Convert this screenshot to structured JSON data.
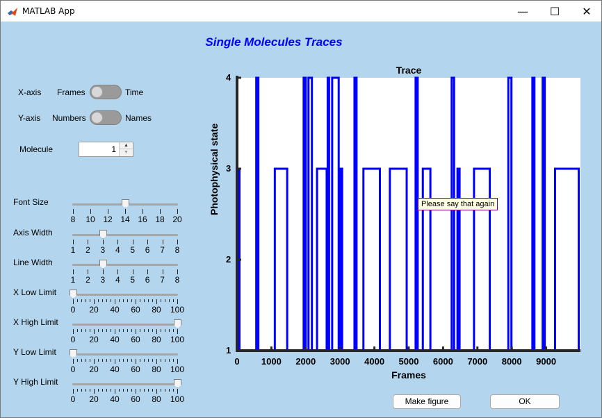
{
  "window": {
    "title": "MATLAB App",
    "minimize_glyph": "—",
    "maximize_glyph": "☐",
    "close_glyph": "✕",
    "app_icon": "matlab-logo-icon"
  },
  "header": {
    "title": "Single Molecules Traces"
  },
  "controls": {
    "xaxis": {
      "label": "X-axis",
      "left": "Frames",
      "right": "Time",
      "state": "Frames"
    },
    "yaxis": {
      "label": "Y-axis",
      "left": "Numbers",
      "right": "Names",
      "state": "Numbers"
    },
    "molecule": {
      "label": "Molecule",
      "value": "1"
    }
  },
  "sliders": [
    {
      "label": "Font Size",
      "min": 8,
      "max": 20,
      "value": 14,
      "major": [
        8,
        10,
        12,
        14,
        16,
        18,
        20
      ],
      "minor": []
    },
    {
      "label": "Axis Width",
      "min": 1,
      "max": 8,
      "value": 3,
      "major": [
        1,
        2,
        3,
        4,
        5,
        6,
        7,
        8
      ],
      "minor": []
    },
    {
      "label": "Line Width",
      "min": 1,
      "max": 8,
      "value": 3,
      "major": [
        1,
        2,
        3,
        4,
        5,
        6,
        7,
        8
      ],
      "minor": []
    },
    {
      "label": "X Low Limit",
      "min": 0,
      "max": 100,
      "value": 0,
      "major": [
        0,
        20,
        40,
        60,
        80,
        100
      ],
      "minor_step": 4
    },
    {
      "label": "X High Limit",
      "min": 0,
      "max": 100,
      "value": 100,
      "major": [
        0,
        20,
        40,
        60,
        80,
        100
      ],
      "minor_step": 4
    },
    {
      "label": "Y Low Limit",
      "min": 0,
      "max": 100,
      "value": 0,
      "major": [
        0,
        20,
        40,
        60,
        80,
        100
      ],
      "minor_step": 4
    },
    {
      "label": "Y High Limit",
      "min": 0,
      "max": 100,
      "value": 100,
      "major": [
        0,
        20,
        40,
        60,
        80,
        100
      ],
      "minor_step": 4
    }
  ],
  "tooltip": {
    "text": "Please say that again"
  },
  "buttons": {
    "make_figure": "Make figure",
    "ok": "OK"
  },
  "colors": {
    "background": "#b3d6ee",
    "trace": "#0000ff",
    "title": "#0000ff"
  },
  "chart_data": {
    "type": "line",
    "title": "Trace",
    "xlabel": "Frames",
    "ylabel": "Photophysical state",
    "xlim": [
      0,
      10000
    ],
    "ylim": [
      1,
      4
    ],
    "xticks": [
      0,
      1000,
      2000,
      3000,
      4000,
      5000,
      6000,
      7000,
      8000,
      9000
    ],
    "yticks": [
      1,
      2,
      3,
      4
    ],
    "grid": false,
    "series": [
      {
        "color": "#0000ff",
        "steps": [
          [
            0,
            3
          ],
          [
            70,
            1
          ],
          [
            560,
            4
          ],
          [
            620,
            1
          ],
          [
            1100,
            3
          ],
          [
            1460,
            1
          ],
          [
            1940,
            4
          ],
          [
            2000,
            1
          ],
          [
            2080,
            4
          ],
          [
            2180,
            1
          ],
          [
            2330,
            3
          ],
          [
            2610,
            1
          ],
          [
            2640,
            4
          ],
          [
            2680,
            1
          ],
          [
            2770,
            4
          ],
          [
            2960,
            1
          ],
          [
            3000,
            3
          ],
          [
            3060,
            1
          ],
          [
            3420,
            4
          ],
          [
            3480,
            1
          ],
          [
            3680,
            3
          ],
          [
            4160,
            1
          ],
          [
            4450,
            3
          ],
          [
            4940,
            1
          ],
          [
            5200,
            4
          ],
          [
            5260,
            1
          ],
          [
            5410,
            3
          ],
          [
            5630,
            1
          ],
          [
            6250,
            4
          ],
          [
            6320,
            1
          ],
          [
            6420,
            3
          ],
          [
            6480,
            1
          ],
          [
            6900,
            3
          ],
          [
            7360,
            1
          ],
          [
            7900,
            4
          ],
          [
            7990,
            1
          ],
          [
            8600,
            4
          ],
          [
            8660,
            1
          ],
          [
            8900,
            4
          ],
          [
            8960,
            1
          ],
          [
            9260,
            3
          ],
          [
            9950,
            1
          ]
        ]
      }
    ]
  }
}
